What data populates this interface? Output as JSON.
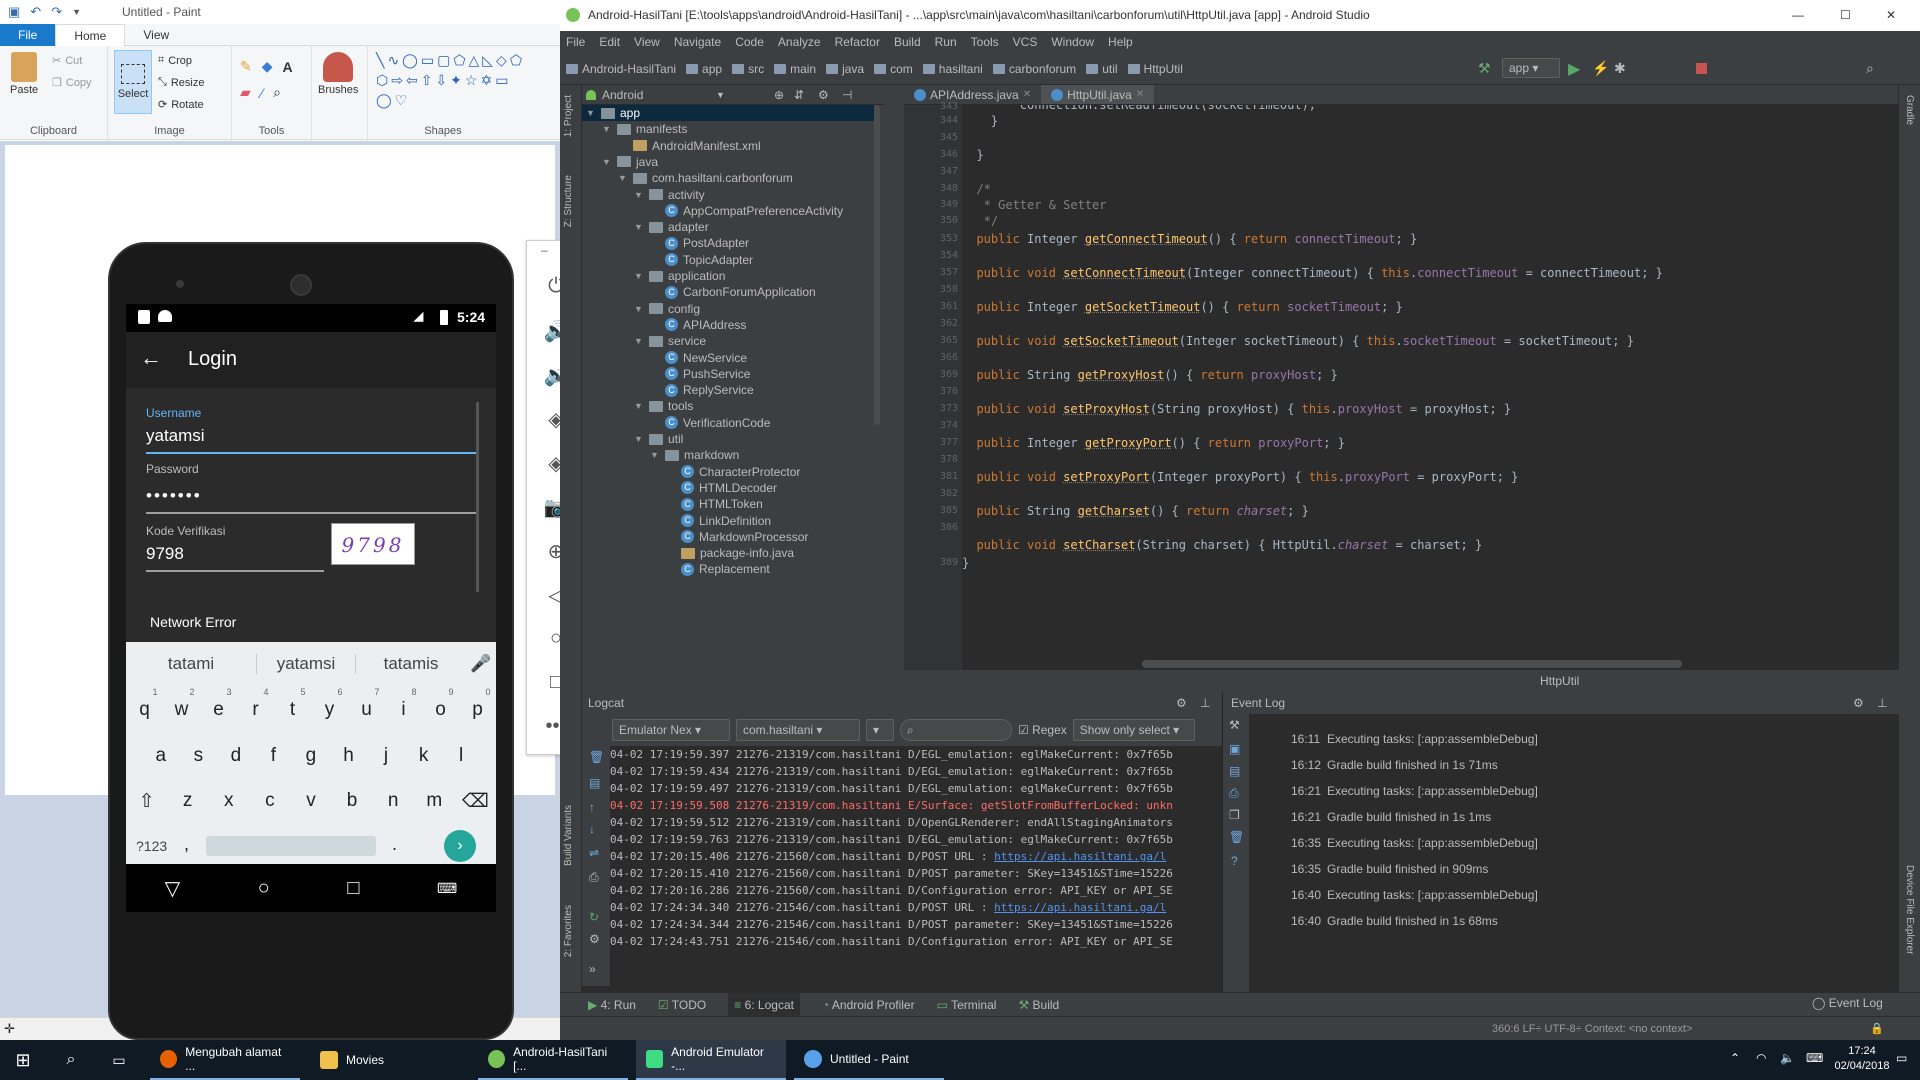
{
  "paint": {
    "title": "Untitled - Paint",
    "tabs": [
      "File",
      "Home",
      "View"
    ],
    "clipboard": {
      "paste": "Paste",
      "cut": "Cut",
      "copy": "Copy",
      "label": "Clipboard"
    },
    "image": {
      "select": "Select",
      "crop": "Crop",
      "resize": "Resize",
      "rotate": "Rotate",
      "label": "Image"
    },
    "tools_label": "Tools",
    "brushes": "Brushes",
    "shapes_label": "Shapes"
  },
  "phone": {
    "time": "5:24",
    "app_title": "Login",
    "username_label": "Username",
    "username_value": "yatamsi",
    "password_label": "Password",
    "password_value": "•••••••",
    "code_label": "Kode Verifikasi",
    "code_value": "9798",
    "captcha": "9798",
    "network_error": "Network Error",
    "suggestions": [
      "tatami",
      "yatamsi",
      "tatamis"
    ],
    "row1": [
      "q",
      "w",
      "e",
      "r",
      "t",
      "y",
      "u",
      "i",
      "o",
      "p"
    ],
    "row1_nums": [
      "1",
      "2",
      "3",
      "4",
      "5",
      "6",
      "7",
      "8",
      "9",
      "0"
    ],
    "row2": [
      "a",
      "s",
      "d",
      "f",
      "g",
      "h",
      "j",
      "k",
      "l"
    ],
    "row3": [
      "z",
      "x",
      "c",
      "v",
      "b",
      "n",
      "m"
    ],
    "sym_key": "?123",
    "comma": ",",
    "period": "."
  },
  "studio": {
    "title": "Android-HasilTani [E:\\tools\\apps\\android\\Android-HasilTani] - ...\\app\\src\\main\\java\\com\\hasiltani\\carbonforum\\util\\HttpUtil.java [app] - Android Studio",
    "menu": [
      "File",
      "Edit",
      "View",
      "Navigate",
      "Code",
      "Analyze",
      "Refactor",
      "Build",
      "Run",
      "Tools",
      "VCS",
      "Window",
      "Help"
    ],
    "breadcrumbs": [
      "Android-HasilTani",
      "app",
      "src",
      "main",
      "java",
      "com",
      "hasiltani",
      "carbonforum",
      "util",
      "HttpUtil"
    ],
    "run_config": "app",
    "project_view": "Android",
    "tabs": [
      "APIAddress.java",
      "HttpUtil.java"
    ],
    "tree": [
      {
        "label": "app",
        "depth": 0,
        "kind": "folder",
        "sel": true
      },
      {
        "label": "manifests",
        "depth": 1,
        "kind": "folder"
      },
      {
        "label": "AndroidManifest.xml",
        "depth": 2,
        "kind": "file"
      },
      {
        "label": "java",
        "depth": 1,
        "kind": "folder"
      },
      {
        "label": "com.hasiltani.carbonforum",
        "depth": 2,
        "kind": "folder"
      },
      {
        "label": "activity",
        "depth": 3,
        "kind": "folder"
      },
      {
        "label": "AppCompatPreferenceActivity",
        "depth": 4,
        "kind": "class"
      },
      {
        "label": "adapter",
        "depth": 3,
        "kind": "folder"
      },
      {
        "label": "PostAdapter",
        "depth": 4,
        "kind": "class"
      },
      {
        "label": "TopicAdapter",
        "depth": 4,
        "kind": "class"
      },
      {
        "label": "application",
        "depth": 3,
        "kind": "folder"
      },
      {
        "label": "CarbonForumApplication",
        "depth": 4,
        "kind": "class"
      },
      {
        "label": "config",
        "depth": 3,
        "kind": "folder"
      },
      {
        "label": "APIAddress",
        "depth": 4,
        "kind": "class"
      },
      {
        "label": "service",
        "depth": 3,
        "kind": "folder"
      },
      {
        "label": "NewService",
        "depth": 4,
        "kind": "class"
      },
      {
        "label": "PushService",
        "depth": 4,
        "kind": "class"
      },
      {
        "label": "ReplyService",
        "depth": 4,
        "kind": "class"
      },
      {
        "label": "tools",
        "depth": 3,
        "kind": "folder"
      },
      {
        "label": "VerificationCode",
        "depth": 4,
        "kind": "class"
      },
      {
        "label": "util",
        "depth": 3,
        "kind": "folder"
      },
      {
        "label": "markdown",
        "depth": 4,
        "kind": "folder"
      },
      {
        "label": "CharacterProtector",
        "depth": 5,
        "kind": "class"
      },
      {
        "label": "HTMLDecoder",
        "depth": 5,
        "kind": "class"
      },
      {
        "label": "HTMLToken",
        "depth": 5,
        "kind": "class"
      },
      {
        "label": "LinkDefinition",
        "depth": 5,
        "kind": "class"
      },
      {
        "label": "MarkdownProcessor",
        "depth": 5,
        "kind": "class"
      },
      {
        "label": "package-info.java",
        "depth": 5,
        "kind": "file"
      },
      {
        "label": "Replacement",
        "depth": 5,
        "kind": "class"
      }
    ],
    "line_numbers": [
      "343",
      "344",
      "345",
      "346",
      "347",
      "348",
      "349",
      "350",
      "353",
      "354",
      "357",
      "358",
      "361",
      "362",
      "365",
      "366",
      "369",
      "370",
      "373",
      "374",
      "377",
      "378",
      "381",
      "382",
      "385",
      "386",
      "389"
    ],
    "editor_crumb": "HttpUtil",
    "logcat_title": "Logcat",
    "device": "Emulator Nex",
    "process": "com.hasiltani",
    "regex": "Regex",
    "filter": "Show only select",
    "log": [
      {
        "text": "04-02 17:19:59.397 21276-21319/com.hasiltani D/EGL_emulation: eglMakeCurrent: 0x7f65b",
        "err": false
      },
      {
        "text": "04-02 17:19:59.434 21276-21319/com.hasiltani D/EGL_emulation: eglMakeCurrent: 0x7f65b",
        "err": false
      },
      {
        "text": "04-02 17:19:59.497 21276-21319/com.hasiltani D/EGL_emulation: eglMakeCurrent: 0x7f65b",
        "err": false
      },
      {
        "text": "04-02 17:19:59.508 21276-21319/com.hasiltani E/Surface: getSlotFromBufferLocked: unkn",
        "err": true
      },
      {
        "text": "04-02 17:19:59.512 21276-21319/com.hasiltani D/OpenGLRenderer: endAllStagingAnimators",
        "err": false
      },
      {
        "text": "04-02 17:19:59.763 21276-21319/com.hasiltani D/EGL_emulation: eglMakeCurrent: 0x7f65b",
        "err": false
      },
      {
        "text": "04-02 17:20:15.406 21276-21560/com.hasiltani D/POST URL : ",
        "url": "https://api.hasiltani.ga/l",
        "err": false
      },
      {
        "text": "04-02 17:20:15.410 21276-21560/com.hasiltani D/POST parameter: SKey=13451&STime=15226",
        "err": false
      },
      {
        "text": "04-02 17:20:16.286 21276-21560/com.hasiltani D/Configuration error: API_KEY or API_SE",
        "err": false
      },
      {
        "text": "04-02 17:24:34.340 21276-21546/com.hasiltani D/POST URL : ",
        "url": "https://api.hasiltani.ga/l",
        "err": false
      },
      {
        "text": "04-02 17:24:34.344 21276-21546/com.hasiltani D/POST parameter: SKey=13451&STime=15226",
        "err": false
      },
      {
        "text": "04-02 17:24:43.751 21276-21546/com.hasiltani D/Configuration error: API_KEY or API_SE",
        "err": false
      }
    ],
    "eventlog_title": "Event Log",
    "events": [
      {
        "time": "16:11",
        "msg": "Executing tasks: [:app:assembleDebug]"
      },
      {
        "time": "16:12",
        "msg": "Gradle build finished in 1s 71ms"
      },
      {
        "time": "16:21",
        "msg": "Executing tasks: [:app:assembleDebug]"
      },
      {
        "time": "16:21",
        "msg": "Gradle build finished in 1s 1ms"
      },
      {
        "time": "16:35",
        "msg": "Executing tasks: [:app:assembleDebug]"
      },
      {
        "time": "16:35",
        "msg": "Gradle build finished in 909ms"
      },
      {
        "time": "16:40",
        "msg": "Executing tasks: [:app:assembleDebug]"
      },
      {
        "time": "16:40",
        "msg": "Gradle build finished in 1s 68ms"
      }
    ],
    "tool_tabs": [
      "4: Run",
      "TODO",
      "6: Logcat",
      "Android Profiler",
      "Terminal",
      "Build"
    ],
    "event_log_tab": "Event Log",
    "status": "360:6   LF÷   UTF-8÷   Context: <no context>"
  },
  "taskbar": {
    "items": [
      "Mengubah alamat ...",
      "Movies",
      "Android-HasilTani [...",
      "Android Emulator -...",
      "Untitled - Paint"
    ],
    "time": "17:24",
    "date": "02/04/2018"
  },
  "colors": {
    "accent": "#1979ca",
    "studio_bg": "#3c3f41",
    "editor_bg": "#2b2b2b",
    "taskbar": "#101a24",
    "fab": "#26a69a"
  }
}
